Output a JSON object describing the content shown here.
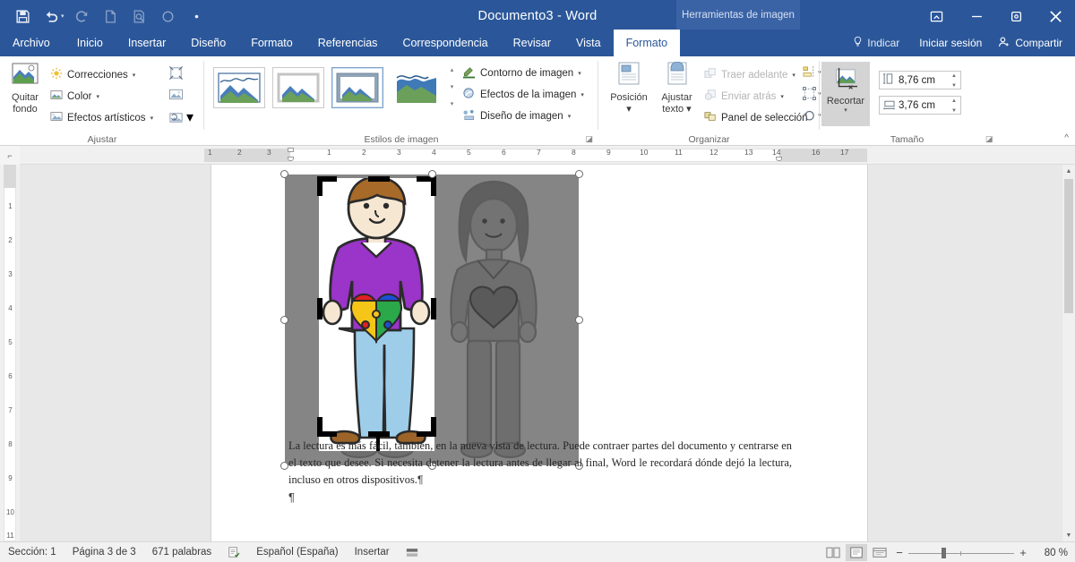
{
  "titlebar": {
    "document_title": "Documento3 - Word",
    "contextual_tab": "Herramientas de imagen",
    "quick_access": [
      {
        "name": "save",
        "icon": "save-icon"
      },
      {
        "name": "undo",
        "icon": "undo-icon"
      },
      {
        "name": "redo",
        "icon": "redo-icon"
      },
      {
        "name": "new",
        "icon": "new-document-icon"
      },
      {
        "name": "print-preview",
        "icon": "print-preview-icon"
      },
      {
        "name": "touch-mode",
        "icon": "circle-icon"
      },
      {
        "name": "customize",
        "icon": "dot-icon"
      }
    ],
    "window_controls": {
      "ribbon_display": "ribbon-display-options-icon",
      "minimize": "minimize-icon",
      "restore": "restore-icon",
      "close": "close-icon"
    }
  },
  "tabs": [
    {
      "label": "Archivo",
      "active": false
    },
    {
      "label": "Inicio",
      "active": false
    },
    {
      "label": "Insertar",
      "active": false
    },
    {
      "label": "Diseño",
      "active": false
    },
    {
      "label": "Formato",
      "active": false
    },
    {
      "label": "Referencias",
      "active": false
    },
    {
      "label": "Correspondencia",
      "active": false
    },
    {
      "label": "Revisar",
      "active": false
    },
    {
      "label": "Vista",
      "active": false
    },
    {
      "label": "Formato",
      "active": true
    }
  ],
  "tabs_right": {
    "tell_me": "Indicar",
    "sign_in": "Iniciar sesión",
    "share": "Compartir"
  },
  "ribbon": {
    "groups": [
      {
        "name": "Ajustar",
        "label": "Ajustar",
        "big_button": {
          "line1": "Quitar",
          "line2": "fondo",
          "icon": "remove-background-icon"
        },
        "commands": [
          {
            "label": "Correcciones",
            "icon": "corrections-icon",
            "caret": "▾"
          },
          {
            "label": "Color",
            "icon": "color-icon",
            "caret": "▾"
          },
          {
            "label": "Efectos artísticos",
            "icon": "artistic-effects-icon",
            "caret": "▾"
          }
        ],
        "small_icons": [
          {
            "name": "compress-pictures-icon"
          },
          {
            "name": "change-picture-icon"
          },
          {
            "name": "reset-picture-icon",
            "caret": "▾"
          }
        ]
      },
      {
        "name": "Estilos de imagen",
        "label": "Estilos de imagen",
        "gallery_items": [
          {
            "name": "style-simple-frame",
            "selected": false
          },
          {
            "name": "style-white-border",
            "selected": false
          },
          {
            "name": "style-beveled-matte",
            "selected": true
          },
          {
            "name": "style-plain-no-border",
            "selected": false
          }
        ],
        "commands": [
          {
            "label": "Contorno de imagen",
            "icon": "picture-border-icon",
            "caret": "▾"
          },
          {
            "label": "Efectos de la imagen",
            "icon": "picture-effects-icon",
            "caret": "▾"
          },
          {
            "label": "Diseño de imagen",
            "icon": "picture-layout-icon",
            "caret": "▾"
          }
        ],
        "dialog_launcher": "◪"
      },
      {
        "name": "Organizar",
        "label": "Organizar",
        "big_buttons": [
          {
            "line1": "Posición",
            "line2": "▾",
            "icon": "position-icon"
          },
          {
            "line1": "Ajustar",
            "line2": "texto ▾",
            "icon": "wrap-text-icon"
          }
        ],
        "commands": [
          {
            "label": "Traer adelante",
            "icon": "bring-forward-icon",
            "caret": "▾",
            "disabled": true
          },
          {
            "label": "Enviar atrás",
            "icon": "send-backward-icon",
            "caret": "▾",
            "disabled": true
          },
          {
            "label": "Panel de selección",
            "icon": "selection-pane-icon",
            "disabled": false
          }
        ],
        "right_commands": [
          {
            "name": "align-icon",
            "caret": "▾"
          },
          {
            "name": "group-icon",
            "caret": "▾"
          },
          {
            "name": "rotate-icon",
            "caret": "▾"
          }
        ]
      },
      {
        "name": "Tamaño",
        "label": "Tamaño",
        "crop_button": {
          "label": "Recortar",
          "caret": "▾",
          "icon": "crop-icon",
          "active": true
        },
        "height": {
          "icon": "shape-height-icon",
          "value": "8,76 cm"
        },
        "width": {
          "icon": "shape-width-icon",
          "value": "3,76 cm"
        },
        "dialog_launcher": "◪"
      }
    ],
    "collapse_ribbon": "^"
  },
  "rulers": {
    "horizontal_ticks": [
      "1",
      "2",
      "3",
      "1",
      "1",
      "2",
      "3",
      "4",
      "5",
      "6",
      "7",
      "8",
      "9",
      "10",
      "11",
      "12",
      "13",
      "14",
      "16",
      "17"
    ],
    "horizontal_left_margin_ticks": [
      "1",
      "2",
      "3"
    ],
    "horizontal_page_ticks": [
      "1",
      "2",
      "3",
      "4",
      "5",
      "6",
      "7",
      "8",
      "9",
      "10",
      "11",
      "12",
      "13",
      "14"
    ],
    "horizontal_right_margin_ticks": [
      "16",
      "17"
    ],
    "vertical_ticks": [
      "1",
      "2",
      "3",
      "4",
      "5",
      "6",
      "7",
      "8",
      "9",
      "10",
      "11"
    ],
    "corner_icon": "tab-stop-icon"
  },
  "document": {
    "image": {
      "alt": "Ilustración de un hombre y una mujer; el hombre lleva un jersey morado con un corazón de piezas de puzle",
      "crop_active": true,
      "colors": {
        "gray_overlay": "#858585",
        "sweater": "#9b34c8",
        "jeans": "#9ecdea",
        "hair": "#a86a28",
        "skin": "#f6e7d3",
        "shoes": "#9c6428",
        "puzzle_red": "#e02020",
        "puzzle_blue": "#1a4fd6",
        "puzzle_yellow": "#f5c518",
        "puzzle_green": "#2aa84a"
      }
    },
    "body_text": "La lectura es más fácil, también, en la nueva vista de lectura. Puede contraer partes del documento y centrarse en el texto que desee. Si necesita detener la lectura antes de llegar al final, Word le recordará dónde dejó la lectura, incluso en otros dispositivos.",
    "paragraph_mark": "¶"
  },
  "statusbar": {
    "section": "Sección: 1",
    "page": "Página 3 de 3",
    "words": "671 palabras",
    "proofing_icon": "proofing-errors-icon",
    "language": "Español (España)",
    "insert_mode": "Insertar",
    "macro_icon": "macro-record-icon",
    "views": [
      {
        "name": "read-mode-view",
        "icon": "read-mode-icon",
        "active": false
      },
      {
        "name": "print-layout-view",
        "icon": "print-layout-icon",
        "active": true
      },
      {
        "name": "web-layout-view",
        "icon": "web-layout-icon",
        "active": false
      }
    ],
    "zoom_out": "−",
    "zoom_in": "+",
    "zoom_value": "80 %"
  }
}
